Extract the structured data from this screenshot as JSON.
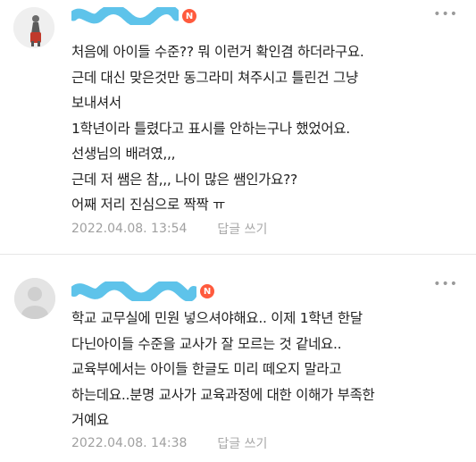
{
  "comments": [
    {
      "badge": "N",
      "more": "•••",
      "lines": [
        "처음에 아이들 수준?? 뭐 이런거 확인겸 하더라구요.",
        "근데 대신 맞은것만 동그라미 쳐주시고 틀린건 그냥",
        "보내셔서",
        "1학년이라 틀렸다고 표시를 안하는구나 했었어요.",
        "선생님의 배려였,,,",
        "근데 저 쌤은 참,,, 나이 많은 쌤인가요??",
        "어째 저리 진심으로 짝짝 ㅠ"
      ],
      "timestamp": "2022.04.08. 13:54",
      "reply_label": "답글 쓰기"
    },
    {
      "badge": "N",
      "more": "•••",
      "lines": [
        "학교 교무실에 민원 넣으셔야해요.. 이제 1학년 한달",
        "다닌아이들 수준을 교사가 잘 모르는 것 같네요..",
        "교육부에서는 아이들 한글도 미리 떼오지 말라고",
        "하는데요..분명 교사가 교육과정에 대한 이해가 부족한",
        "거예요"
      ],
      "timestamp": "2022.04.08. 14:38",
      "reply_label": "답글 쓰기"
    }
  ]
}
